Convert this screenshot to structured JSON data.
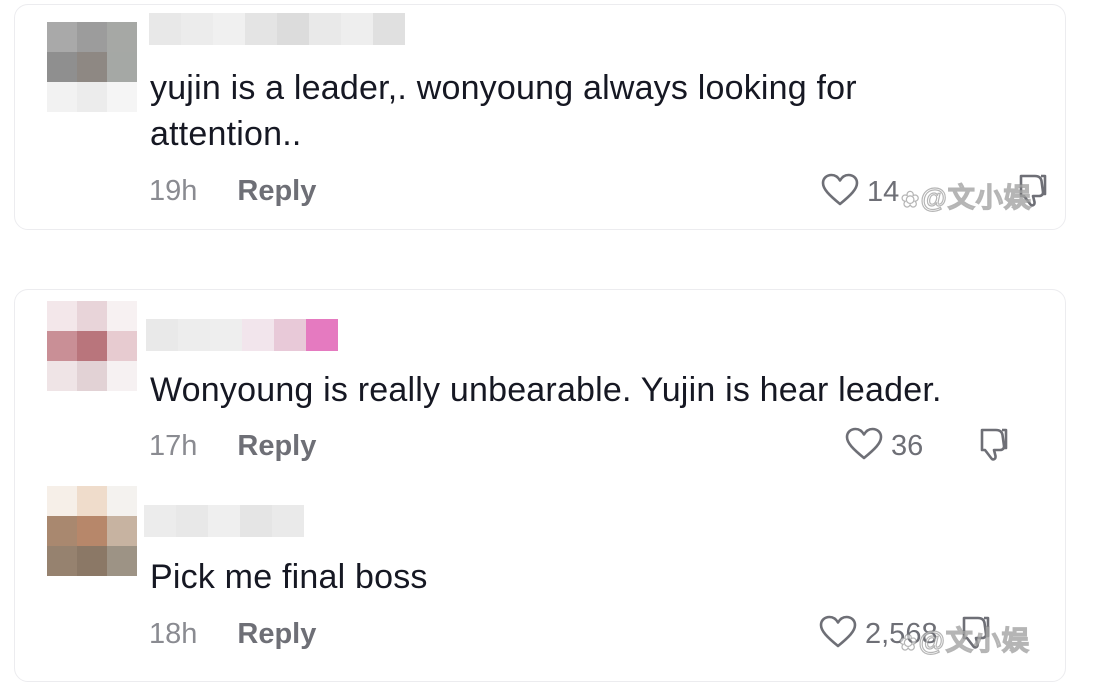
{
  "comments": [
    {
      "text_line1": "yujin is a leader,. wonyoung always looking for",
      "text_line2": "attention..",
      "time": "19h",
      "reply_label": "Reply",
      "likes": "14",
      "avatar_colors": [
        "#a9a9a9",
        "#9c9c9c",
        "#a6a8a5",
        "#8f8f8f",
        "#8e8883",
        "#a5a8a5",
        "#f2f2f2",
        "#ececec",
        "#f5f5f5"
      ],
      "username_colors": [
        "#e8e8e8",
        "#ececec",
        "#f0f0f0",
        "#e4e4e4",
        "#dcdcdc",
        "#e9e9e9",
        "#eeeeee",
        "#e0e0e0"
      ]
    },
    {
      "text": "Wonyoung is really unbearable. Yujin is hear leader.",
      "time": "17h",
      "reply_label": "Reply",
      "likes": "36",
      "avatar_colors": [
        "#f3e7ea",
        "#e8d4d9",
        "#f7f1f2",
        "#c98f96",
        "#b9757c",
        "#e7cbd0",
        "#efe4e6",
        "#e2d2d5",
        "#f6f1f2"
      ],
      "username_colors": [
        "#e9e9e9",
        "#ededed",
        "#eeeeee",
        "#f2e5ec",
        "#e8c9d8",
        "#e57ac0"
      ]
    },
    {
      "text": "Pick me final boss",
      "time": "18h",
      "reply_label": "Reply",
      "likes": "2,568",
      "avatar_colors": [
        "#f6efe8",
        "#efdccb",
        "#f4f2ef",
        "#a9886f",
        "#b7876a",
        "#c7b3a1",
        "#96826f",
        "#8b7866",
        "#9d9385"
      ],
      "username_colors": [
        "#ececec",
        "#e8e8e8",
        "#efefef",
        "#e5e5e5",
        "#eaeaea"
      ]
    }
  ],
  "watermark": "@文小娱",
  "icons": {
    "like": "heart-outline-icon",
    "dislike": "thumbs-down-icon",
    "watermark_logo": "weibo-paw-icon"
  },
  "colors": {
    "text": "#161823",
    "meta": "#8a8b91",
    "reply": "#6e6f76",
    "card_border": "#ececef"
  }
}
